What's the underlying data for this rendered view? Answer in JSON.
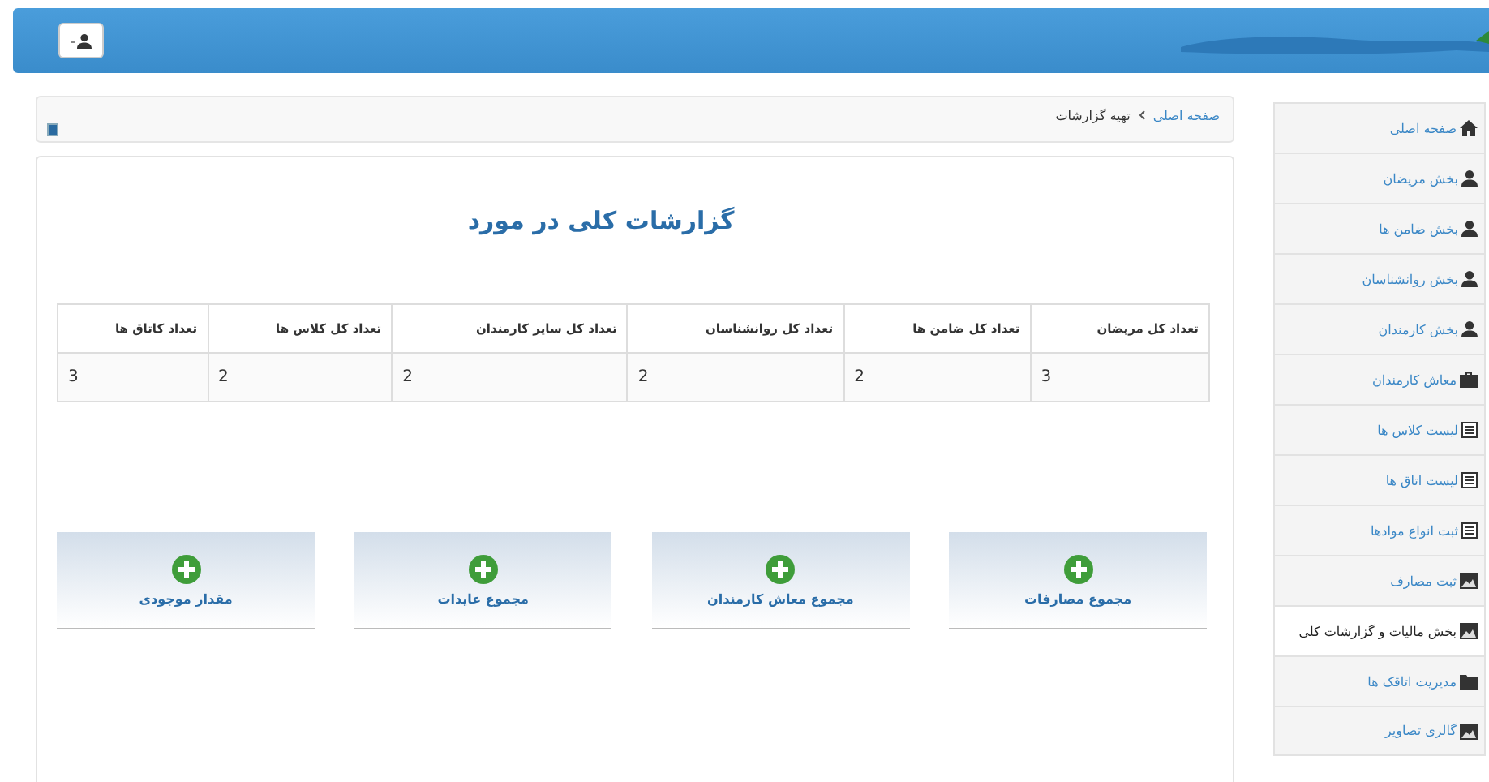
{
  "sidebar": {
    "items": [
      {
        "label": "صفحه اصلی",
        "kind": "home",
        "selected": false
      },
      {
        "label": "بخش مریضان",
        "kind": "person",
        "selected": false
      },
      {
        "label": "بخش ضامن ها",
        "kind": "person",
        "selected": false
      },
      {
        "label": "بخش روانشناسان",
        "kind": "person",
        "selected": false
      },
      {
        "label": "بخش کارمندان",
        "kind": "person",
        "selected": false
      },
      {
        "label": "معاش کارمندان",
        "kind": "payroll",
        "selected": false
      },
      {
        "label": "لیست کلاس ها",
        "kind": "list",
        "selected": false
      },
      {
        "label": "لیست اتاق ها",
        "kind": "list",
        "selected": false
      },
      {
        "label": "ثبت انواع موادها",
        "kind": "list",
        "selected": false
      },
      {
        "label": "ثبت مصارف",
        "kind": "media",
        "selected": false
      },
      {
        "label": "بخش مالیات و گزارشات کلی",
        "kind": "media",
        "selected": true
      },
      {
        "label": "مدیریت اتاقک ها",
        "kind": "manage",
        "selected": false
      },
      {
        "label": "گالری تصاویر",
        "kind": "media",
        "selected": false
      }
    ]
  },
  "breadcrumb": [
    {
      "label": "صفحه اصلی",
      "kind": "link"
    },
    {
      "label": "تهیه گزارشات",
      "kind": "current"
    }
  ],
  "report": {
    "title": "گزارشات کلی در مورد",
    "table": {
      "columns": [
        "تعداد کل مریضان",
        "تعداد کل ضامن ها",
        "تعداد کل روانشناسان",
        "تعداد کل سایر کارمندان",
        "تعداد کل کلاس ها",
        "تعداد کاتاق ها"
      ],
      "rows": [
        [
          "3",
          "2",
          "2",
          "2",
          "2",
          "3"
        ]
      ]
    },
    "cards": [
      {
        "label": "مجموع مصارفات"
      },
      {
        "label": "مجموع معاش کارمندان"
      },
      {
        "label": "مجموع عایدات"
      },
      {
        "label": "مقدار موجودی"
      }
    ]
  }
}
